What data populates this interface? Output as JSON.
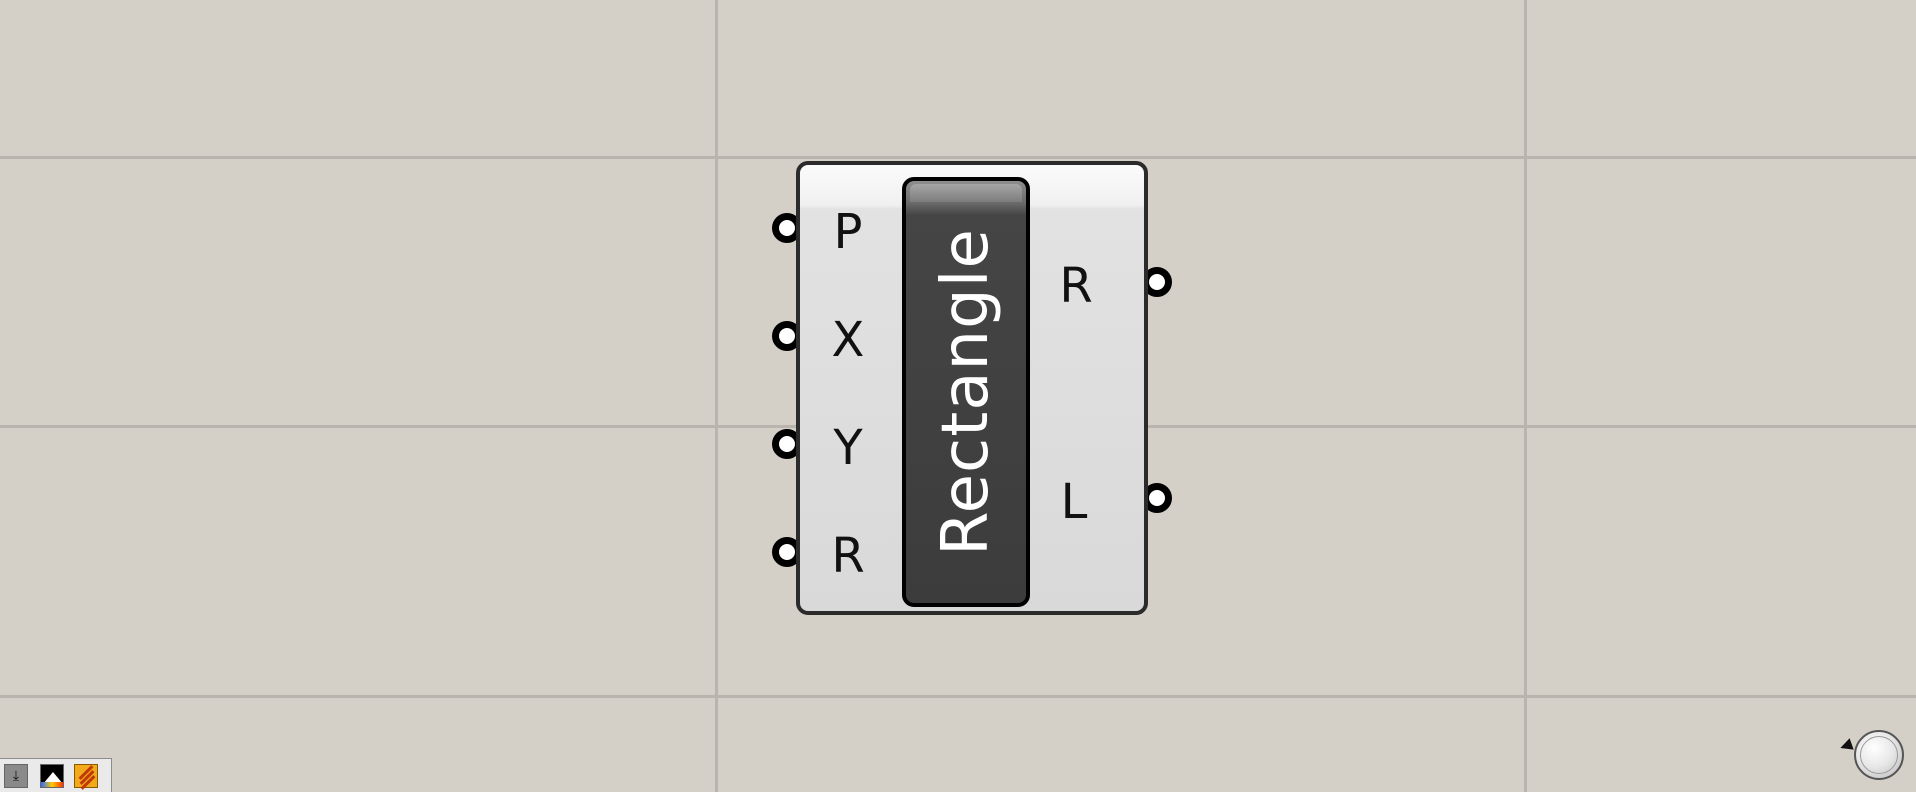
{
  "component": {
    "name": "Rectangle",
    "inputs": [
      {
        "label": "P"
      },
      {
        "label": "X"
      },
      {
        "label": "Y"
      },
      {
        "label": "R"
      }
    ],
    "outputs": [
      {
        "label": "R"
      },
      {
        "label": "L"
      }
    ]
  },
  "toolbar": {
    "buttons": [
      {
        "icon": "download-icon"
      },
      {
        "icon": "render-icon"
      },
      {
        "icon": "flame-icon"
      }
    ]
  },
  "navigation": {
    "icon": "navigation-dial-icon"
  }
}
